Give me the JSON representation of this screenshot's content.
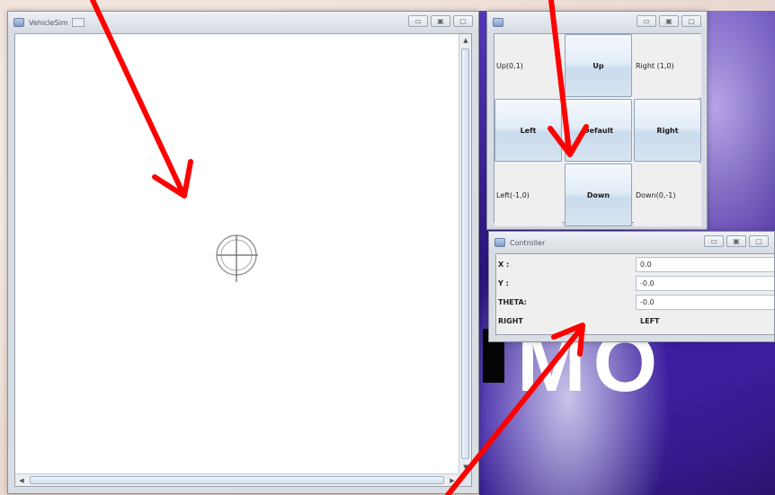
{
  "colors": {
    "arrow": "#ff0000",
    "background_accent": "#3a1c9c"
  },
  "desktop": {
    "big_text": "MO"
  },
  "vehiclesim": {
    "title": "VehicleSim",
    "buttons": {
      "minimize": "▭",
      "maximize": "▣",
      "close": "▢"
    },
    "scroll": {
      "up": "▲",
      "down": "▼",
      "left": "◀",
      "right": "▶"
    }
  },
  "pad": {
    "title": "",
    "buttons": {
      "minimize": "▭",
      "maximize": "▣",
      "close": "▢"
    },
    "cells": {
      "up_left": "Up(0,1)",
      "up": "Up",
      "up_right": "Right (1,0)",
      "left": "Left",
      "default": "Default",
      "right": "Right",
      "down_left": "Left(-1,0)",
      "down": "Down",
      "down_right": "Down(0,-1)"
    }
  },
  "controller": {
    "title": "Controller",
    "buttons": {
      "minimize": "▭",
      "maximize": "▣",
      "close": "▢"
    },
    "x_label": "X  :",
    "x_value": "0.0",
    "y_label": "Y  :",
    "y_value": "-0.0",
    "theta_label": "THETA:",
    "theta_value": "-0.0",
    "right_label": "RIGHT",
    "left_label": "LEFT"
  }
}
